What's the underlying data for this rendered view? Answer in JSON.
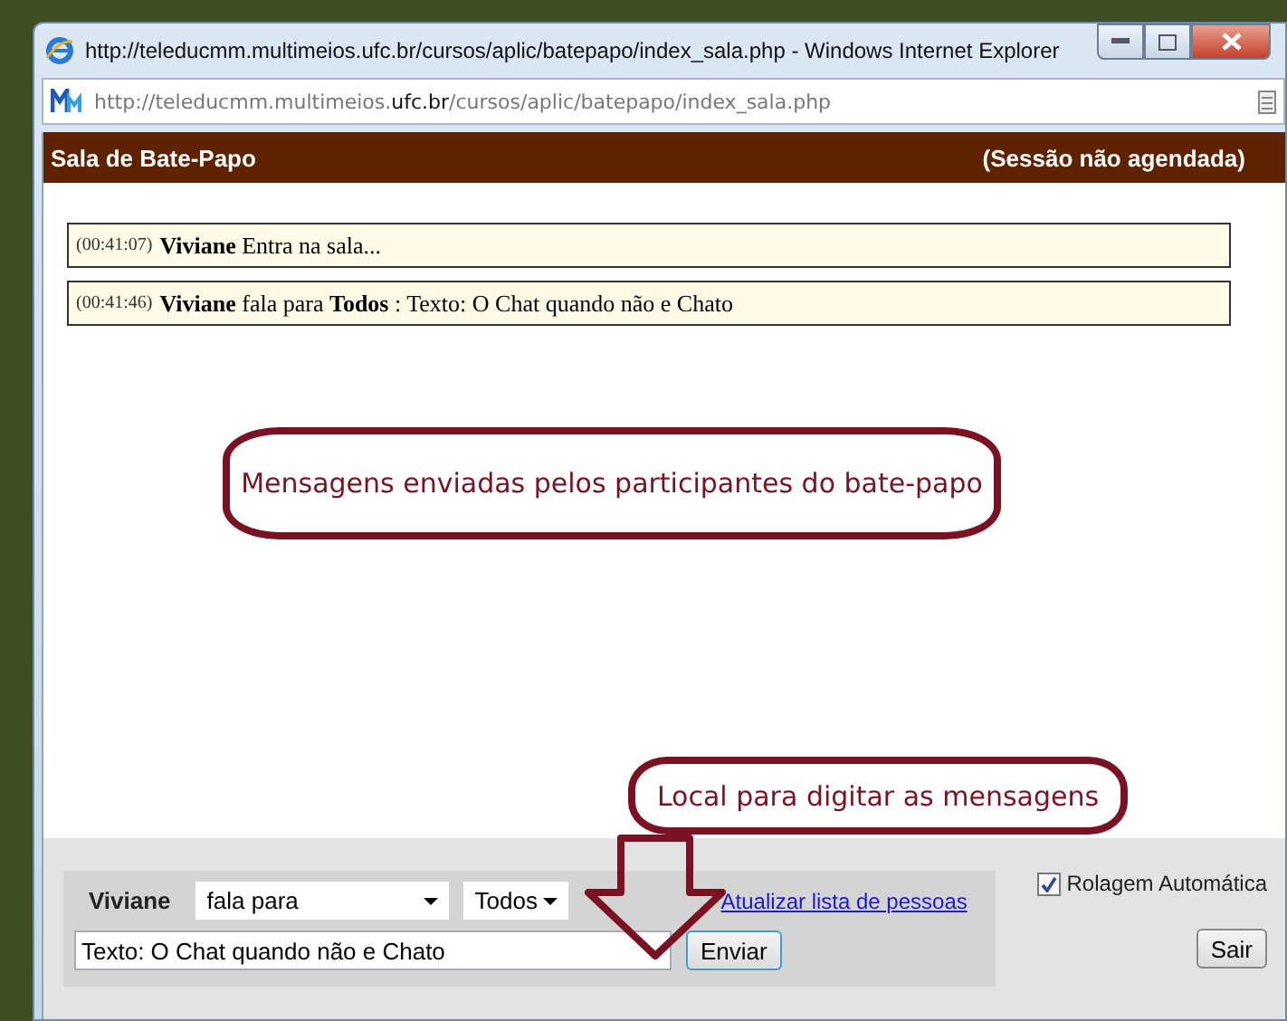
{
  "window": {
    "title": "http://teleducmm.multimeios.ufc.br/cursos/aplic/batepapo/index_sala.php - Windows Internet Explorer"
  },
  "address_bar": {
    "url": "http://teleducmm.multimeios.**ufc.br**/cursos/aplic/batepapo/index_sala.php"
  },
  "header": {
    "title": "Sala de Bate-Papo",
    "status": "(Sessão não agendada)"
  },
  "messages": [
    {
      "time": "(00:41:07)",
      "text": "**Viviane** Entra na sala..."
    },
    {
      "time": "(00:41:46)",
      "text": "**Viviane** fala para **Todos** : Texto: O Chat quando não e Chato"
    }
  ],
  "annotations": [
    "Mensagens enviadas pelos participantes do bate-papo",
    "Local para digitar as mensagens"
  ],
  "composer": {
    "sender": "Viviane",
    "mode": "fala para",
    "recipient": "Todos",
    "link": "Atualizar lista de pessoas",
    "message": "Texto: O Chat quando não e Chato",
    "send": "Enviar",
    "auto_scroll": {
      "label": "Rolagem Automática",
      "checked": true
    },
    "exit": "Sair"
  }
}
